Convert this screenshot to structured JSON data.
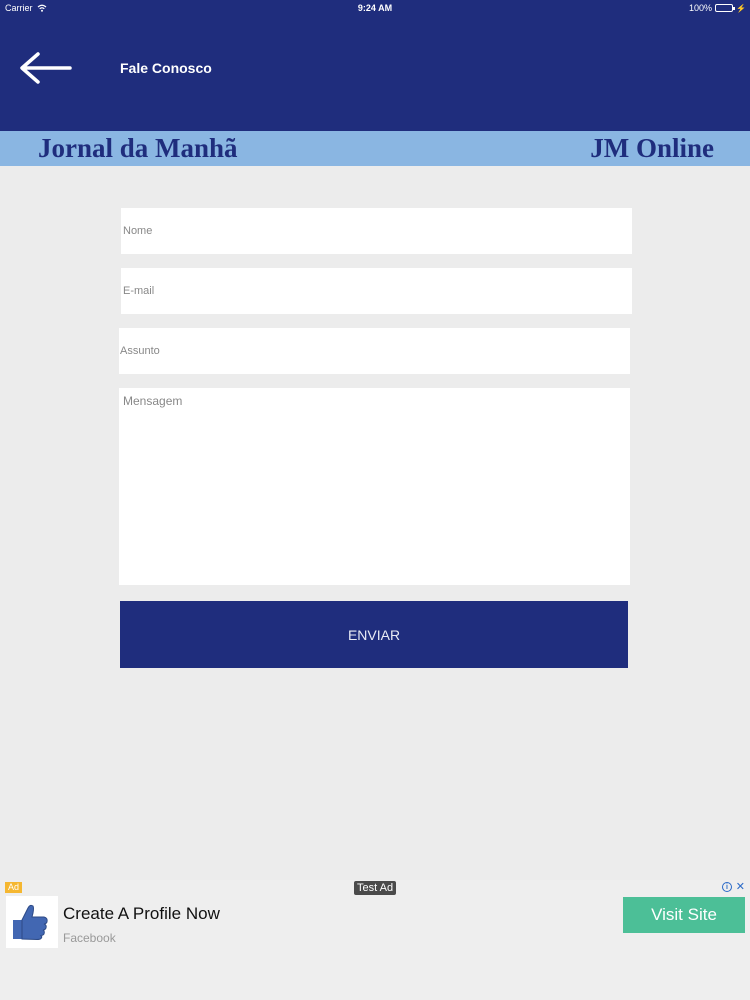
{
  "status_bar": {
    "carrier": "Carrier",
    "time": "9:24 AM",
    "battery": "100%"
  },
  "nav": {
    "title": "Fale Conosco"
  },
  "banner": {
    "left_text": "Jornal da Manhã",
    "right_text": "JM Online"
  },
  "form": {
    "name_placeholder": "Nome",
    "email_placeholder": "E-mail",
    "subject_placeholder": "Assunto",
    "message_placeholder": "Mensagem",
    "submit_label": "ENVIAR"
  },
  "ad": {
    "badge": "Ad",
    "test_label": "Test Ad",
    "title": "Create A Profile Now",
    "subtitle": "Facebook",
    "cta_label": "Visit Site"
  },
  "colors": {
    "header": "#1f2d7d",
    "banner": "#8ab6e2",
    "background": "#ececec",
    "cta": "#4cbf97"
  }
}
